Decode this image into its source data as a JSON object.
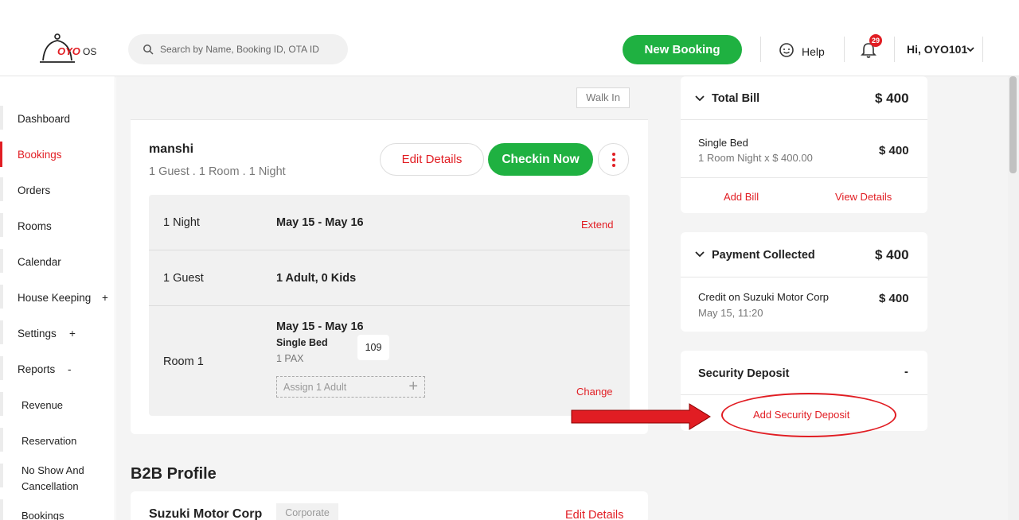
{
  "header": {
    "logo_text": "OYO",
    "logo_suffix": "OS",
    "search_placeholder": "Search by Name, Booking ID, OTA ID",
    "new_booking_label": "New Booking",
    "help_label": "Help",
    "notification_count": "29",
    "user_label": "Hi, OYO101"
  },
  "sidebar": {
    "items": [
      {
        "label": "Dashboard"
      },
      {
        "label": "Bookings",
        "active": true
      },
      {
        "label": "Orders"
      },
      {
        "label": "Rooms"
      },
      {
        "label": "Calendar"
      },
      {
        "label": "House Keeping",
        "suffix": "+"
      },
      {
        "label": "Settings",
        "suffix": "+"
      },
      {
        "label": "Reports",
        "suffix": "-"
      },
      {
        "label": "Revenue"
      },
      {
        "label": "Reservation"
      },
      {
        "label": "No Show And"
      },
      {
        "label": "Cancellation"
      },
      {
        "label": "Bookings"
      }
    ]
  },
  "booking": {
    "source_tag": "Walk In",
    "guest_name": "manshi",
    "summary": "1 Guest . 1 Room . 1 Night",
    "edit_label": "Edit Details",
    "checkin_label": "Checkin Now",
    "rows": {
      "nights_label": "1 Night",
      "dates": "May 15 - May 16",
      "extend_label": "Extend",
      "guests_label": "1 Guest",
      "guests_value": "1 Adult, 0 Kids",
      "room_label": "Room 1",
      "room_dates": "May 15 - May 16",
      "room_type": "Single Bed",
      "room_pax": "1 PAX",
      "room_number": "109",
      "assign_placeholder": "Assign 1 Adult",
      "change_label": "Change"
    }
  },
  "b2b": {
    "section_title": "B2B Profile",
    "company": "Suzuki Motor Corp",
    "tag": "Corporate",
    "edit_label": "Edit Details"
  },
  "bill": {
    "title": "Total Bill",
    "total": "$ 400",
    "item_name": "Single Bed",
    "item_detail": "1 Room Night x $ 400.00",
    "item_amount": "$ 400",
    "add_label": "Add Bill",
    "view_label": "View Details"
  },
  "payment": {
    "title": "Payment Collected",
    "total": "$ 400",
    "entry_name": "Credit on Suzuki Motor Corp",
    "entry_date": "May 15, 11:20",
    "entry_amount": "$ 400"
  },
  "deposit": {
    "title": "Security Deposit",
    "value": "-",
    "add_label": "Add Security Deposit"
  },
  "colors": {
    "brand_red": "#e11d23",
    "brand_green": "#1fb141",
    "annotation_red": "#e11d23"
  }
}
